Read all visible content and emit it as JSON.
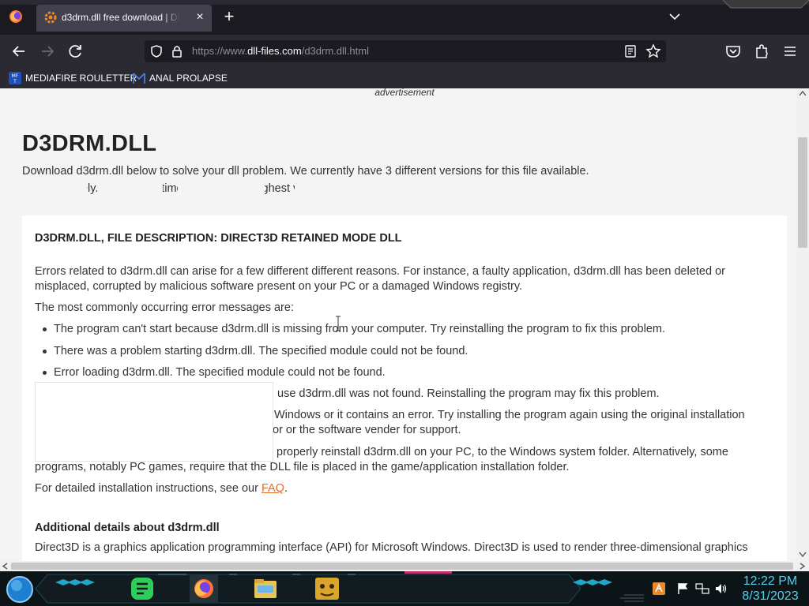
{
  "browser": {
    "tab_title": "d3drm.dll free download | DLL-files.com",
    "tab_close": "×",
    "new_tab": "+",
    "url_prefix": "https://www.",
    "url_host": "dll-files.com",
    "url_path": "/d3drm.dll.html",
    "bookmarks": [
      {
        "label": "MEDIAFIRE ROULETTER",
        "icon": "mediafire-icon"
      },
      {
        "label": "ANAL PROLAPSE",
        "icon": "bookmark-icon"
      }
    ]
  },
  "page": {
    "ad_label": "advertisement",
    "title": "D3DRM.DLL",
    "intro": "Download d3drm.dll below to solve your dll problem. We currently have 3 different versions for this file available.",
    "intro2": "Choose wisely. Most of the time, just pick the highest version.",
    "card_heading": "D3DRM.DLL, FILE DESCRIPTION: DIRECT3D RETAINED MODE DLL",
    "p1_line1": "Errors related to d3drm.dll can arise for a few different different reasons. For instance, a faulty application, d3drm.dll has been deleted or",
    "p1_line2": "misplaced, corrupted by malicious software present on your PC or a damaged Windows registry.",
    "p2": "The most commonly occurring error messages are:",
    "errors": [
      "The program can't start because d3drm.dll is missing from your computer. Try reinstalling the program to fix this problem.",
      "There was a problem starting d3drm.dll. The specified module could not be found.",
      "Error loading d3drm.dll. The specified module could not be found.",
      "use d3drm.dll was not found. Reinstalling the program may fix this problem.",
      "Windows or it contains an error. Try installing the program again using the original installation",
      "or or the software vender for support."
    ],
    "p3_line1": "properly reinstall d3drm.dll on your PC, to the Windows system folder. Alternatively, some",
    "p3_line2": "programs, notably PC games, require that the DLL file is placed in the game/application installation folder.",
    "p4_prefix": "For detailed installation instructions, see our ",
    "faq_label": "FAQ",
    "p4_suffix": ".",
    "details_heading": "Additional details about d3drm.dll",
    "details_text": "Direct3D is a graphics application programming interface (API) for Microsoft Windows. Direct3D is used to render three-dimensional graphics"
  },
  "taskbar": {
    "time": "12:22 PM",
    "date": "8/31/2023"
  },
  "colors": {
    "accent_link": "#e06d2a",
    "clock": "#4fd2f0"
  }
}
